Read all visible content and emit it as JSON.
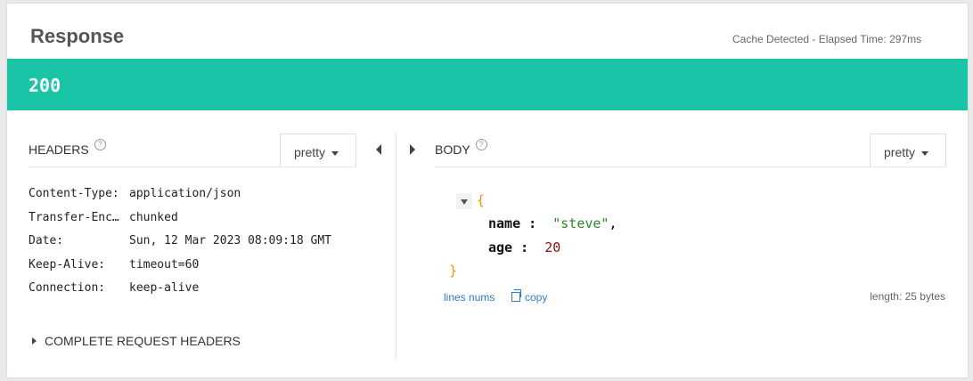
{
  "response": {
    "title": "Response",
    "cache_text": "Cache Detected - Elapsed Time: 297ms",
    "status_code": "200"
  },
  "colors": {
    "status_bar": "#1ac5a7",
    "brace": "#e39a00",
    "string": "#2a8a2a",
    "number": "#8a1010",
    "link": "#2c7cc7"
  },
  "headers": {
    "label": "HEADERS",
    "help_icon": "question-circle-icon",
    "format": "pretty",
    "rows": [
      {
        "key": "Content-Type:",
        "value": "application/json"
      },
      {
        "key": "Transfer-Enc…",
        "value": "chunked"
      },
      {
        "key": "Date:",
        "value": "Sun, 12 Mar 2023 08:09:18 GMT"
      },
      {
        "key": "Keep-Alive:",
        "value": "timeout=60"
      },
      {
        "key": "Connection:",
        "value": "keep-alive"
      }
    ],
    "complete_toggle": "COMPLETE REQUEST HEADERS"
  },
  "body": {
    "label": "BODY",
    "help_icon": "question-circle-icon",
    "format": "pretty",
    "open_brace": "{",
    "close_brace": "}",
    "fields": [
      {
        "key": "name",
        "sep": " :",
        "value": "\"steve\"",
        "trail": ",",
        "kind": "string"
      },
      {
        "key": "age",
        "sep": " :",
        "value": "20",
        "trail": "",
        "kind": "number"
      }
    ],
    "lines_nums": "lines nums",
    "copy": "copy",
    "length": "length: 25 bytes"
  }
}
